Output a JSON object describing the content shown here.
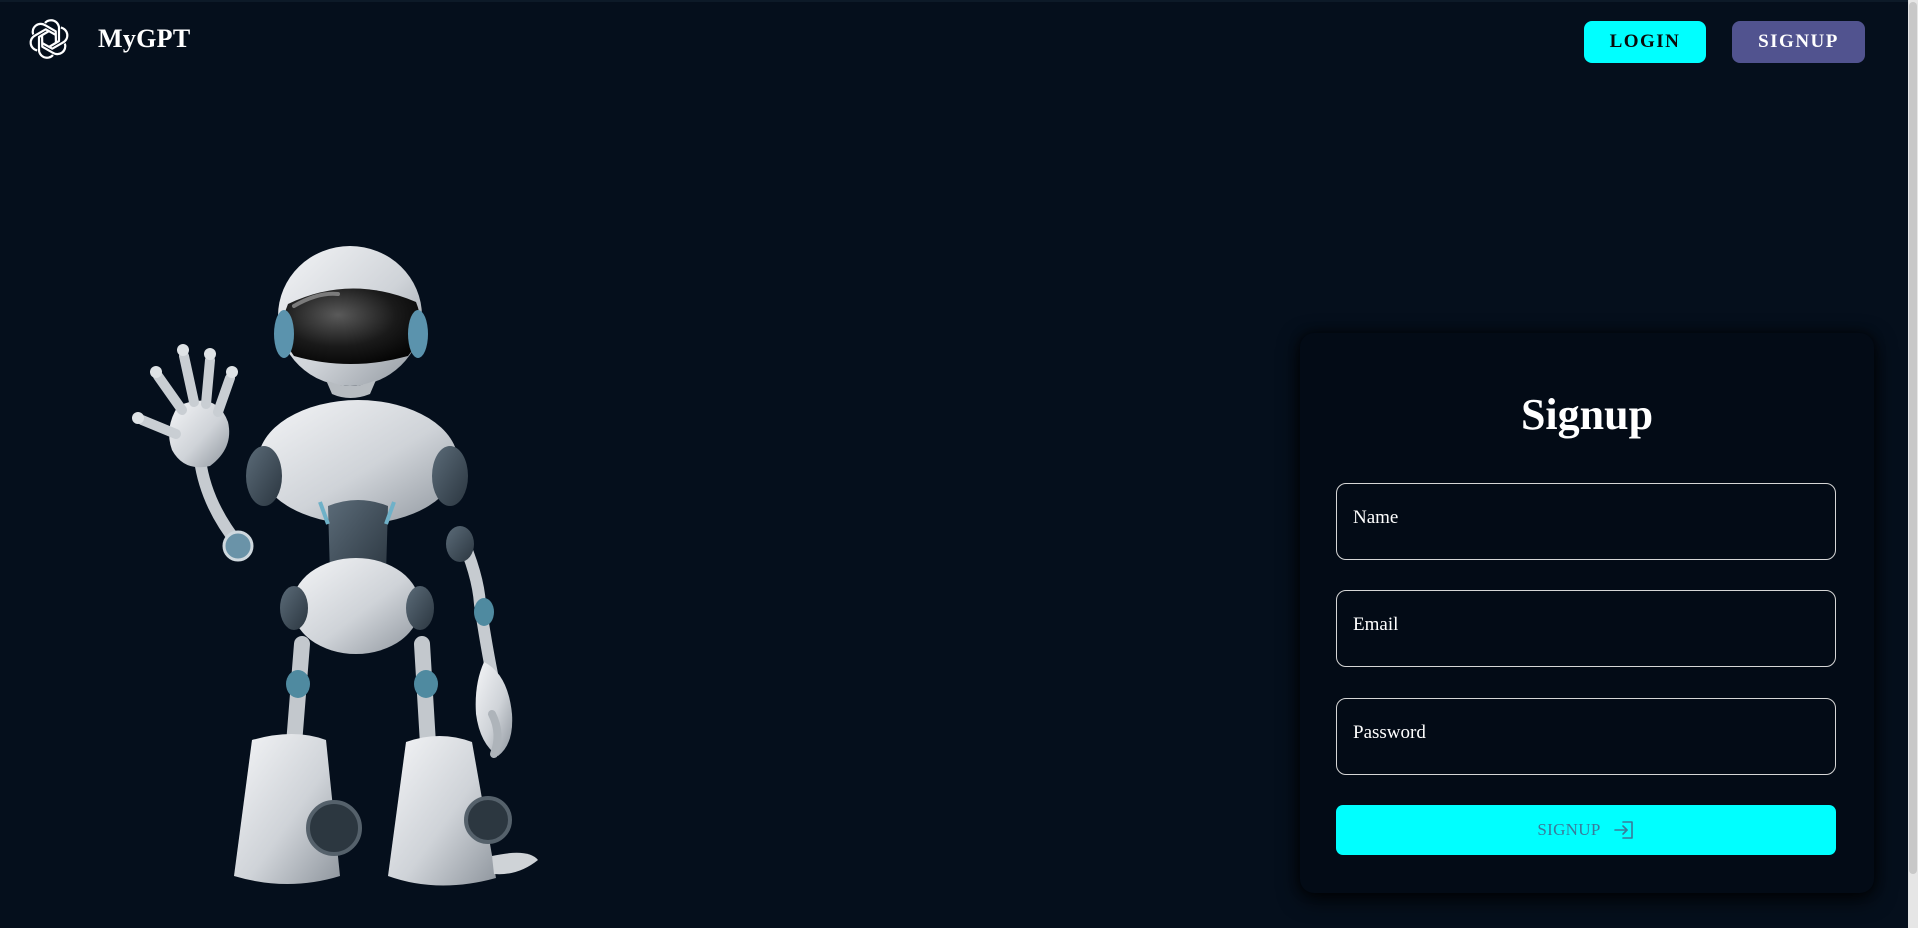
{
  "header": {
    "brand": "MyGPT",
    "login_label": "LOGIN",
    "signup_label": "SIGNUP"
  },
  "card": {
    "title": "Signup",
    "name_placeholder": "Name",
    "email_placeholder": "Email",
    "password_placeholder": "Password",
    "submit_label": "SIGNUP"
  },
  "icons": {
    "logo": "openai-logo-icon",
    "submit": "login-arrow-icon",
    "illustration": "robot-illustration"
  },
  "colors": {
    "background": "#050f1c",
    "card_background": "#030b16",
    "accent": "#00ffff",
    "signup_nav": "#51538f",
    "text": "#ffffff"
  }
}
